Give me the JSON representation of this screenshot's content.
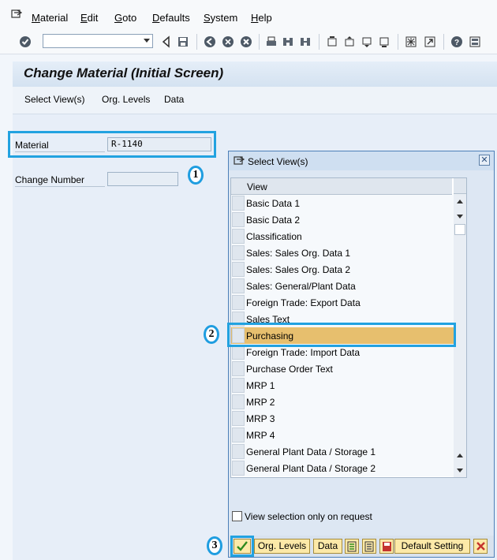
{
  "menu": {
    "items": [
      {
        "label": "Material",
        "accel": "M",
        "rest": "aterial"
      },
      {
        "label": "Edit",
        "accel": "E",
        "rest": "dit"
      },
      {
        "label": "Goto",
        "accel": "G",
        "rest": "oto"
      },
      {
        "label": "Defaults",
        "accel": "D",
        "rest": "efaults"
      },
      {
        "label": "System",
        "accel": "S",
        "rest": "ystem"
      },
      {
        "label": "Help",
        "accel": "H",
        "rest": "elp"
      }
    ]
  },
  "toolbar": {
    "command_value": ""
  },
  "page": {
    "title": "Change Material (Initial Screen)"
  },
  "app_toolbar": {
    "select_views": "Select View(s)",
    "org_levels": "Org. Levels",
    "data": "Data"
  },
  "form": {
    "material_label": "Material",
    "material_value": "R-1140",
    "change_number_label": "Change Number",
    "change_number_value": ""
  },
  "markers": {
    "m1": "1",
    "m2": "2",
    "m3": "3"
  },
  "dialog": {
    "title": "Select View(s)",
    "column_header": "View",
    "rows": [
      "Basic Data 1",
      "Basic Data 2",
      "Classification",
      "Sales: Sales Org. Data 1",
      "Sales: Sales Org. Data 2",
      "Sales: General/Plant Data",
      "Foreign Trade: Export Data",
      "Sales Text",
      "Purchasing",
      "Foreign Trade: Import Data",
      "Purchase Order Text",
      "MRP 1",
      "MRP 2",
      "MRP 3",
      "MRP 4",
      "General Plant Data / Storage 1",
      "General Plant Data / Storage 2"
    ],
    "selected_row": "Purchasing",
    "checkbox_label": "View selection only on request",
    "footer": {
      "org_levels": "Org. Levels",
      "data": "Data",
      "default_setting": "Default Setting"
    }
  },
  "colors": {
    "highlight": "#22a2e0",
    "selected_row": "#e7bf6e",
    "footer_button": "#fce9a8"
  }
}
